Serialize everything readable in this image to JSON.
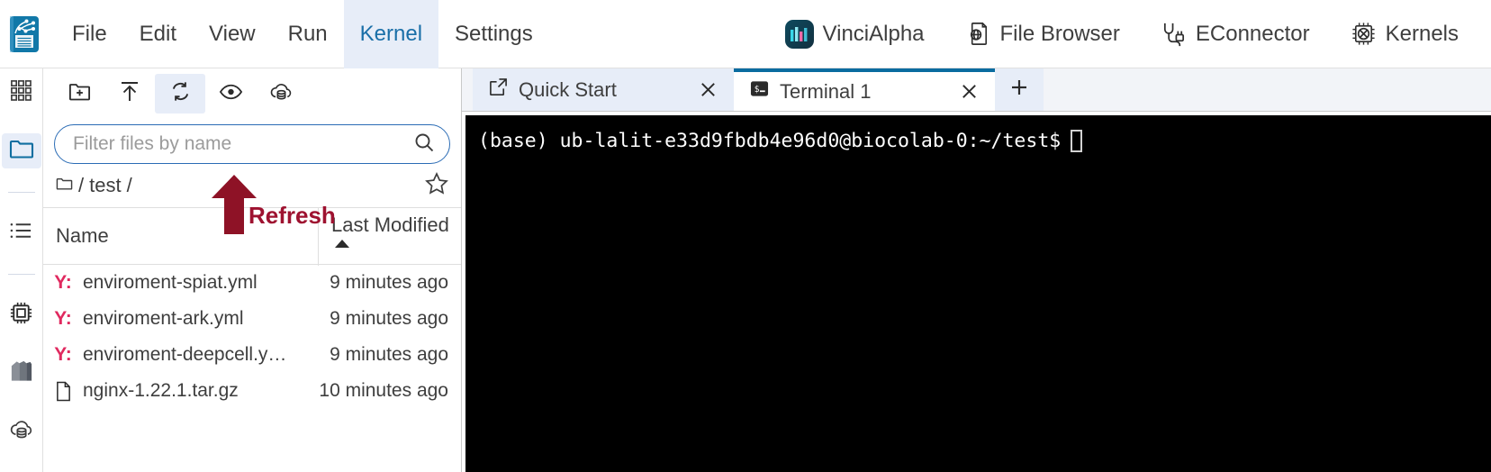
{
  "menubar": {
    "logo_icon": "jupyter-notebook-logo",
    "items": [
      {
        "label": "File",
        "active": false
      },
      {
        "label": "Edit",
        "active": false
      },
      {
        "label": "View",
        "active": false
      },
      {
        "label": "Run",
        "active": false
      },
      {
        "label": "Kernel",
        "active": true
      },
      {
        "label": "Settings",
        "active": false
      }
    ],
    "right_items": [
      {
        "label": "VinciAlpha",
        "icon": "vincialpha-logo-icon"
      },
      {
        "label": "File Browser",
        "icon": "file-browser-globe-icon"
      },
      {
        "label": "EConnector",
        "icon": "plug-connector-icon"
      },
      {
        "label": "Kernels",
        "icon": "cpu-chip-icon"
      }
    ],
    "active_color": "#1a6fa8",
    "active_bg": "#e7edf8"
  },
  "rail": {
    "items": [
      {
        "name": "launcher",
        "icon": "grid-apps-icon",
        "active": false
      },
      {
        "name": "file-browser",
        "icon": "folder-icon",
        "active": true
      },
      {
        "name": "running-terminals",
        "icon": "list-bullet-icon",
        "active": false
      },
      {
        "name": "kernels",
        "icon": "cpu-chip-icon",
        "active": false
      },
      {
        "name": "extensions",
        "icon": "layers-books-icon",
        "active": false
      },
      {
        "name": "cloud-storage",
        "icon": "cloud-database-icon",
        "active": false
      }
    ]
  },
  "filebrowser": {
    "toolbar": [
      {
        "name": "new-folder",
        "icon": "new-folder-plus-icon",
        "active": false
      },
      {
        "name": "upload",
        "icon": "upload-arrow-icon",
        "active": false
      },
      {
        "name": "refresh",
        "icon": "refresh-arrows-icon",
        "active": true
      },
      {
        "name": "toggle-hidden",
        "icon": "eye-icon",
        "active": false
      },
      {
        "name": "cloud-sync",
        "icon": "cloud-database-icon",
        "active": false
      }
    ],
    "filter": {
      "placeholder": "Filter files by name",
      "value": "",
      "search_icon": "search-magnifier-icon"
    },
    "breadcrumb": {
      "root_icon": "folder-outline-icon",
      "separator": "/",
      "path_segment": "test",
      "trailing_separator": "/",
      "favorite_icon": "star-outline-icon"
    },
    "columns": {
      "name": "Name",
      "last_modified": "Last Modified",
      "sort_direction": "ascending"
    },
    "files": [
      {
        "icon": "yaml-file-icon",
        "icon_glyph": "Y:",
        "name": "enviroment-spiat.yml",
        "modified": "9 minutes ago"
      },
      {
        "icon": "yaml-file-icon",
        "icon_glyph": "Y:",
        "name": "enviroment-ark.yml",
        "modified": "9 minutes ago"
      },
      {
        "icon": "yaml-file-icon",
        "icon_glyph": "Y:",
        "name": "enviroment-deepcell.y…",
        "modified": "9 minutes ago"
      },
      {
        "icon": "generic-file-icon",
        "icon_glyph": "",
        "name": "nginx-1.22.1.tar.gz",
        "modified": "10 minutes ago"
      }
    ]
  },
  "annotation": {
    "label": "Refresh",
    "color": "#9e1230",
    "target": "refresh-button"
  },
  "main": {
    "tabs": [
      {
        "label": "Quick Start",
        "icon": "external-link-icon",
        "current": false,
        "close_icon": "close-x-icon"
      },
      {
        "label": "Terminal 1",
        "icon": "terminal-prompt-icon",
        "current": true,
        "close_icon": "close-x-icon"
      }
    ],
    "add_tab_icon": "plus-icon",
    "terminal": {
      "prompt": "(base) ub-lalit-e33d9fbdb4e96d0@biocolab-0:~/test$",
      "input": "",
      "cursor": "block-hollow",
      "background": "#000000",
      "foreground": "#ffffff"
    }
  }
}
